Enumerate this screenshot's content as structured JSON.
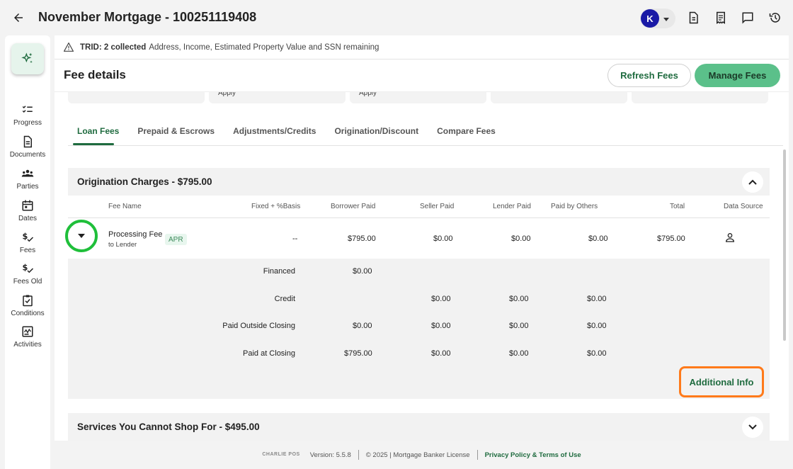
{
  "header": {
    "title": "November Mortgage - 100251119408",
    "avatar_initial": "K"
  },
  "sidebar": {
    "items": [
      {
        "label": "Progress",
        "icon": "checklist-icon"
      },
      {
        "label": "Documents",
        "icon": "document-icon"
      },
      {
        "label": "Parties",
        "icon": "people-icon"
      },
      {
        "label": "Dates",
        "icon": "calendar-icon"
      },
      {
        "label": "Fees",
        "icon": "dollar-check-icon"
      },
      {
        "label": "Fees Old",
        "icon": "dollar-check-icon"
      },
      {
        "label": "Conditions",
        "icon": "clipboard-check-icon"
      },
      {
        "label": "Activities",
        "icon": "activity-icon"
      }
    ]
  },
  "trid": {
    "label": "TRID: 2 collected",
    "remaining": "Address, Income, Estimated Property Value and SSN remaining"
  },
  "fee_details": {
    "title": "Fee details",
    "refresh_label": "Refresh Fees",
    "manage_label": "Manage Fees",
    "summary_cards": [
      "",
      "Apply",
      "Apply",
      "",
      ""
    ]
  },
  "tabs": [
    "Loan Fees",
    "Prepaid & Escrows",
    "Adjustments/Credits",
    "Origination/Discount",
    "Compare Fees"
  ],
  "origination": {
    "title": "Origination Charges - $795.00",
    "columns": [
      "Fee Name",
      "Fixed + %Basis",
      "Borrower Paid",
      "Seller Paid",
      "Lender Paid",
      "Paid by Others",
      "Total",
      "Data Source"
    ],
    "fee": {
      "name": "Processing Fee",
      "sub": "to Lender",
      "badge": "APR",
      "basis": "--",
      "borrower": "$795.00",
      "seller": "$0.00",
      "lender": "$0.00",
      "others": "$0.00",
      "total": "$795.00"
    },
    "details": [
      {
        "label": "Financed",
        "borrower": "$0.00",
        "seller": "",
        "lender": "",
        "others": ""
      },
      {
        "label": "Credit",
        "borrower": "",
        "seller": "$0.00",
        "lender": "$0.00",
        "others": "$0.00"
      },
      {
        "label": "Paid Outside Closing",
        "borrower": "$0.00",
        "seller": "$0.00",
        "lender": "$0.00",
        "others": "$0.00"
      },
      {
        "label": "Paid at Closing",
        "borrower": "$795.00",
        "seller": "$0.00",
        "lender": "$0.00",
        "others": "$0.00"
      }
    ],
    "additional_info": "Additional Info"
  },
  "services": {
    "title": "Services You Cannot Shop For - $495.00"
  },
  "footer": {
    "logo_text": "CHARLIE POS",
    "version": "Version: 5.5.8",
    "copyright": "© 2025 | Mortgage Banker License",
    "link": "Privacy Policy & Terms of Use"
  },
  "colors": {
    "brand_green": "#1f6b3f",
    "button_green": "#5bc08a",
    "highlight_circle": "#1fbf3a",
    "highlight_box": "#ff7a1a",
    "avatar_blue": "#1a1aa6"
  }
}
